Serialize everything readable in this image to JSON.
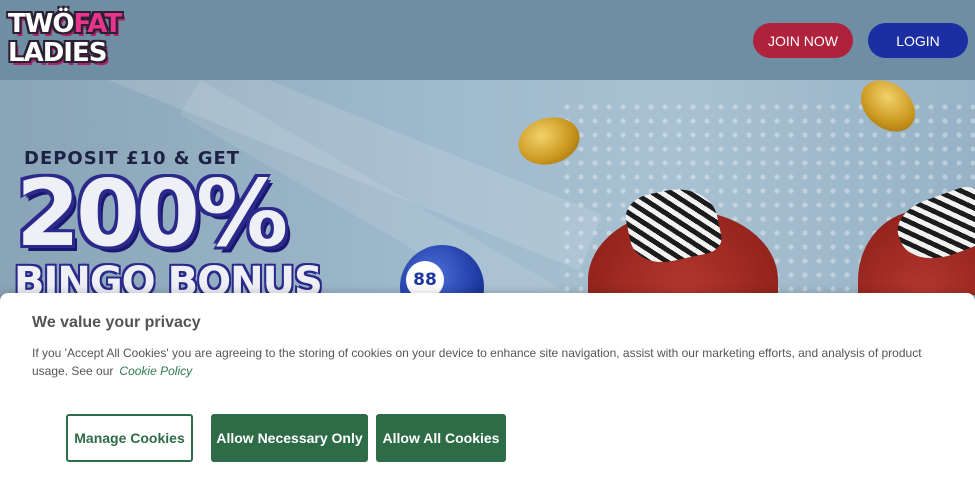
{
  "header": {
    "logo_line1_a": "TWÖ",
    "logo_line1_b": "FAT",
    "logo_line2": "LADIES",
    "join_label": "JOIN NOW",
    "login_label": "LOGIN"
  },
  "hero": {
    "promo_line1": "DEPOSIT £10 & GET",
    "promo_big": "200%",
    "promo_bonus": "BINGO BONUS",
    "ball_number": "88"
  },
  "cookie_banner": {
    "title": "We value your privacy",
    "text": "If you 'Accept All Cookies' you are agreeing to the storing of cookies on your device to enhance site navigation, assist with our marketing efforts, and analysis of product usage. See our",
    "policy_link": "Cookie Policy",
    "manage_label": "Manage Cookies",
    "necessary_label": "Allow Necessary Only",
    "all_label": "Allow All Cookies"
  },
  "colors": {
    "join": "#b0213c",
    "login": "#1b2fa3",
    "cookie_accent": "#2e6b47"
  }
}
